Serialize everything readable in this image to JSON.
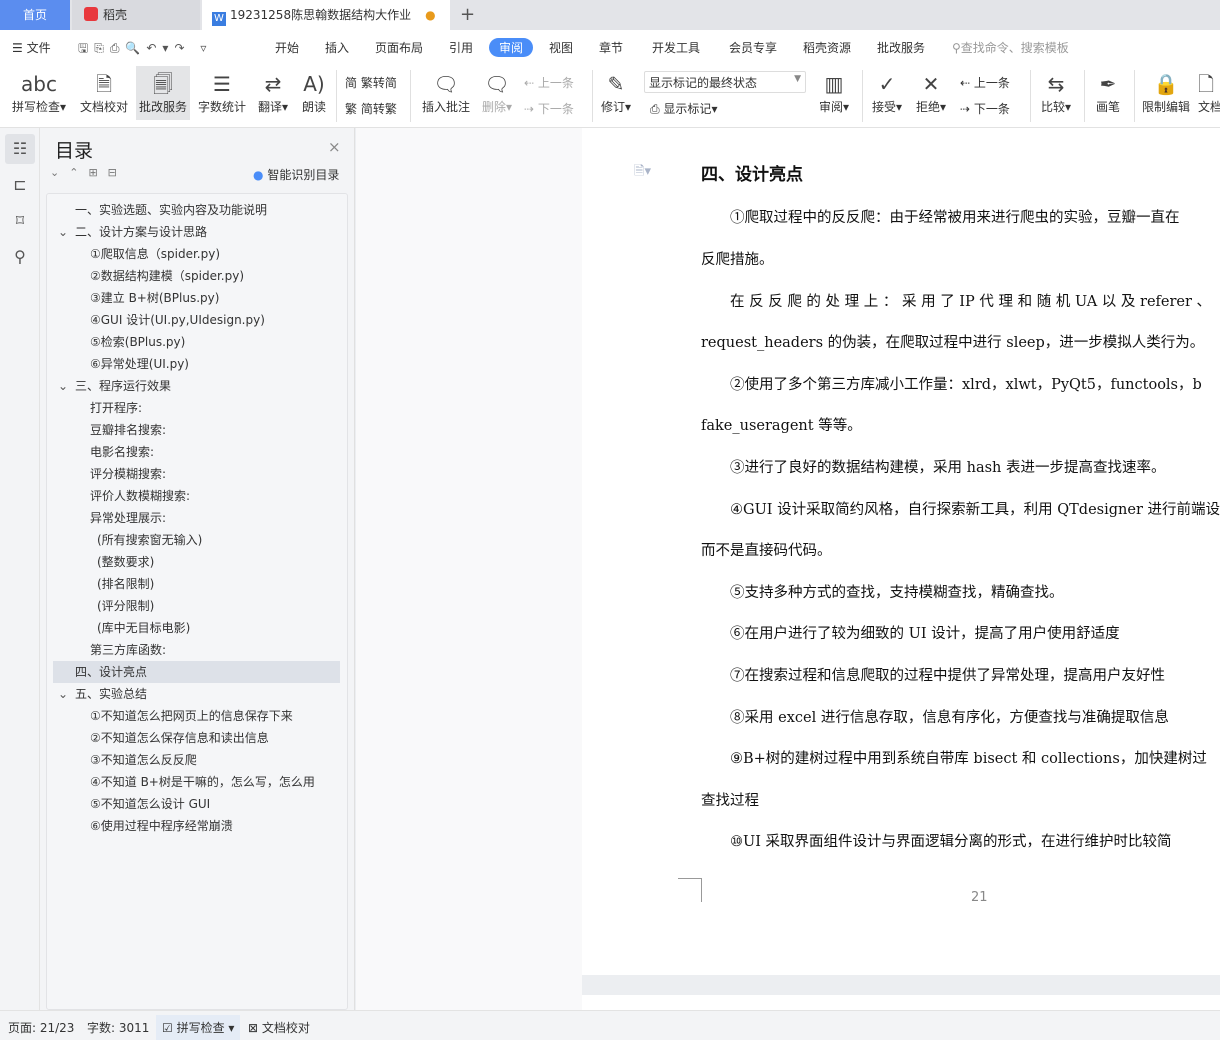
{
  "tabs": {
    "home": "首页",
    "daoke": "稻壳",
    "doc": "19231258陈思翰数据结构大作业",
    "new": "+"
  },
  "colors": {
    "accent": "#4a8df8",
    "home_tab": "#5b8def",
    "selected_toc": "#dde1e8"
  },
  "menu": {
    "file": "文件",
    "items": [
      "开始",
      "插入",
      "页面布局",
      "引用",
      "审阅",
      "视图",
      "章节",
      "开发工具",
      "会员专享",
      "稻壳资源",
      "批改服务"
    ],
    "active": "审阅",
    "search_placeholder": "查找命令、搜索模板"
  },
  "ribbon": {
    "spell": "拼写检查",
    "proof": "文档校对",
    "correct": "批改服务",
    "count": "字数统计",
    "translate": "翻译",
    "read": "朗读",
    "t2s": "繁转简",
    "s2t": "简转繁",
    "insert_comment": "插入批注",
    "delete": "删除",
    "prev": "上一条",
    "next": "下一条",
    "track": "修订",
    "markup_state": "显示标记的最终状态",
    "show_markup": "显示标记",
    "review": "审阅",
    "accept": "接受",
    "reject": "拒绝",
    "prev2": "上一条",
    "next2": "下一条",
    "compare": "比较",
    "pen": "画笔",
    "restrict": "限制编辑",
    "doc_perm": "文档"
  },
  "nav": {
    "title": "目录",
    "smart": "智能识别目录",
    "items": [
      {
        "t": "一、实验选题、实验内容及功能说明",
        "lv": 1
      },
      {
        "t": "二、设计方案与设计思路",
        "lv": 1,
        "exp": true
      },
      {
        "t": "①爬取信息（spider.py)",
        "lv": 2
      },
      {
        "t": "②数据结构建模（spider.py)",
        "lv": 2
      },
      {
        "t": "③建立 B+树(BPlus.py)",
        "lv": 2
      },
      {
        "t": "④GUI 设计(UI.py,UIdesign.py)",
        "lv": 2
      },
      {
        "t": "⑤检索(BPlus.py)",
        "lv": 2
      },
      {
        "t": "⑥异常处理(UI.py)",
        "lv": 2
      },
      {
        "t": "三、程序运行效果",
        "lv": 1,
        "exp": true
      },
      {
        "t": "打开程序:",
        "lv": 2
      },
      {
        "t": "豆瓣排名搜索:",
        "lv": 2
      },
      {
        "t": "电影名搜索:",
        "lv": 2
      },
      {
        "t": "评分模糊搜索:",
        "lv": 2
      },
      {
        "t": "评价人数模糊搜索:",
        "lv": 2
      },
      {
        "t": "异常处理展示:",
        "lv": 2
      },
      {
        "t": "(所有搜索窗无输入)",
        "lv": 3
      },
      {
        "t": "(整数要求)",
        "lv": 3
      },
      {
        "t": "(排名限制)",
        "lv": 3
      },
      {
        "t": "(评分限制)",
        "lv": 3
      },
      {
        "t": "(库中无目标电影)",
        "lv": 3
      },
      {
        "t": "第三方库函数:",
        "lv": 2
      },
      {
        "t": "四、设计亮点",
        "lv": 1,
        "sel": true
      },
      {
        "t": "五、实验总结",
        "lv": 1,
        "exp": true
      },
      {
        "t": "①不知道怎么把网页上的信息保存下来",
        "lv": 2
      },
      {
        "t": "②不知道怎么保存信息和读出信息",
        "lv": 2
      },
      {
        "t": "③不知道怎么反反爬",
        "lv": 2
      },
      {
        "t": "④不知道 B+树是干嘛的，怎么写，怎么用",
        "lv": 2
      },
      {
        "t": "⑤不知道怎么设计 GUI",
        "lv": 2
      },
      {
        "t": "⑥使用过程中程序经常崩溃",
        "lv": 2
      }
    ]
  },
  "doc": {
    "heading": "四、设计亮点",
    "page_number": "21",
    "lines": [
      {
        "t": "①爬取过程中的反反爬：由于经常被用来进行爬虫的实验，豆瓣一直在",
        "i": true
      },
      {
        "t": "反爬措施。",
        "i": false
      },
      {
        "t": "在 反 反 爬 的 处 理 上 ： 采 用 了 IP 代 理 和 随 机 UA 以 及 referer 、",
        "i": true
      },
      {
        "t": "request_headers 的伪装，在爬取过程中进行 sleep，进一步模拟人类行为。",
        "i": false
      },
      {
        "t": "②使用了多个第三方库减小工作量：xlrd，xlwt，PyQt5，functools，b",
        "i": true
      },
      {
        "t": "fake_useragent 等等。",
        "i": false
      },
      {
        "t": "③进行了良好的数据结构建模，采用 hash 表进一步提高查找速率。",
        "i": true
      },
      {
        "t": "④GUI 设计采取简约风格，自行探索新工具，利用 QTdesigner 进行前端设",
        "i": true
      },
      {
        "t": "而不是直接码代码。",
        "i": false
      },
      {
        "t": "⑤支持多种方式的查找，支持模糊查找，精确查找。",
        "i": true
      },
      {
        "t": "⑥在用户进行了较为细致的 UI 设计，提高了用户使用舒适度",
        "i": true
      },
      {
        "t": "⑦在搜索过程和信息爬取的过程中提供了异常处理，提高用户友好性",
        "i": true
      },
      {
        "t": "⑧采用 excel 进行信息存取，信息有序化，方便查找与准确提取信息",
        "i": true
      },
      {
        "t": "⑨B+树的建树过程中用到系统自带库 bisect 和 collections，加快建树过",
        "i": true
      },
      {
        "t": "查找过程",
        "i": false
      },
      {
        "t": "⑩UI 采取界面组件设计与界面逻辑分离的形式，在进行维护时比较简",
        "i": true
      }
    ]
  },
  "status": {
    "page": "页面: 21/23",
    "words": "字数: 3011",
    "spell": "拼写检查",
    "proof": "文档校对"
  }
}
